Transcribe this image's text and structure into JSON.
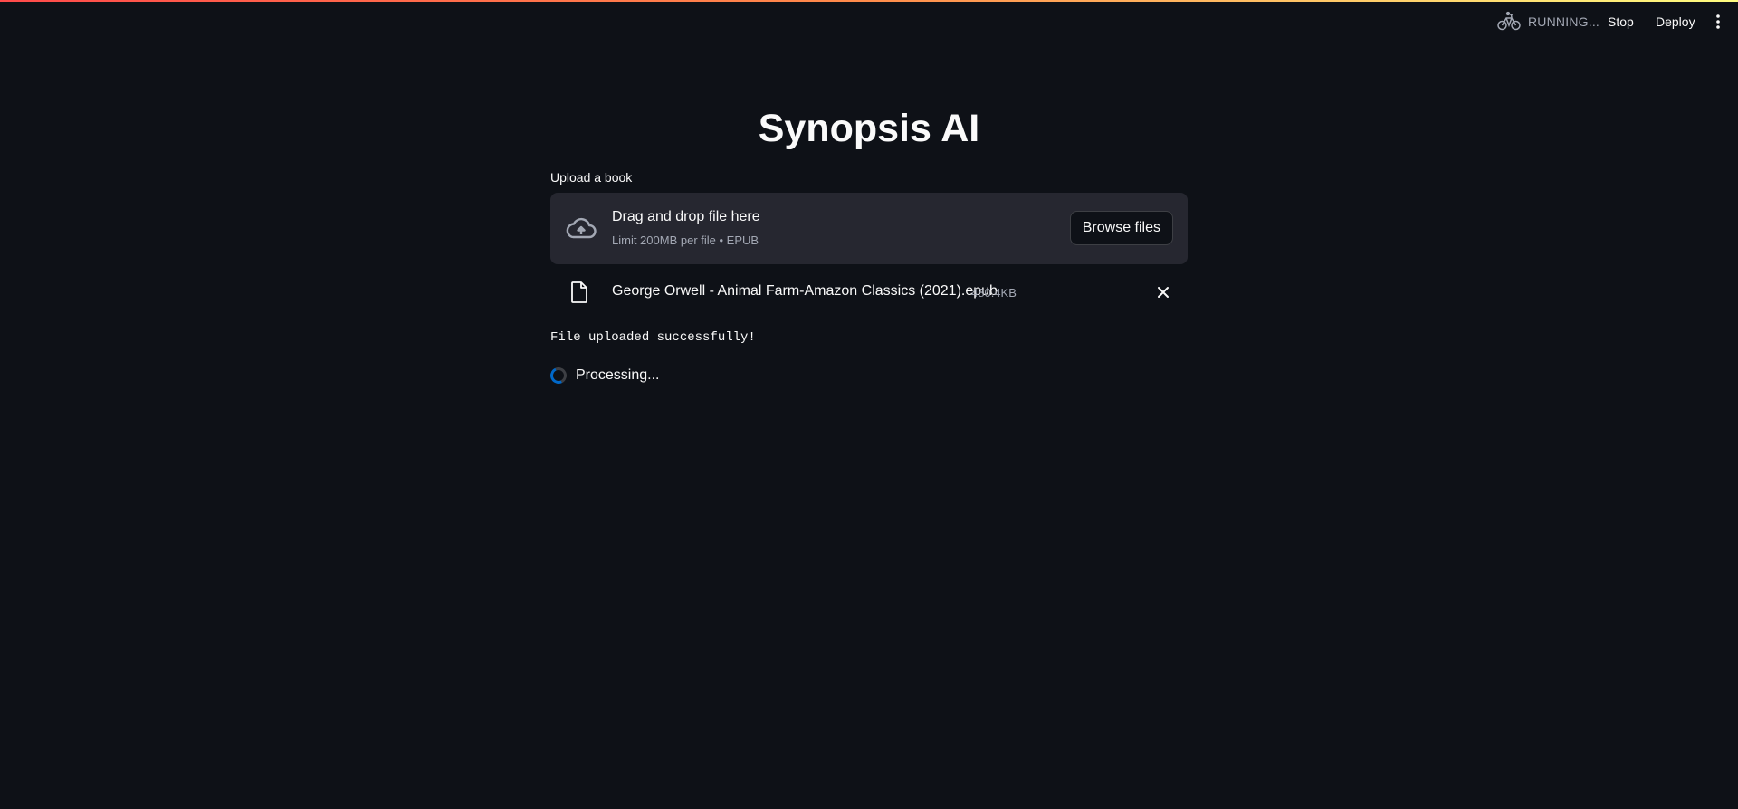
{
  "header": {
    "status": {
      "icon": "bicycle-icon",
      "text": "RUNNING..."
    },
    "stop_label": "Stop",
    "deploy_label": "Deploy",
    "menu_icon": "vertical-ellipsis-icon"
  },
  "main": {
    "title": "Synopsis AI",
    "uploader": {
      "label": "Upload a book",
      "drop_title": "Drag and drop file here",
      "limit_text": "Limit 200MB per file • EPUB",
      "browse_label": "Browse files",
      "upload_icon": "cloud-upload-icon"
    },
    "uploaded_file": {
      "icon": "file-icon",
      "name": "George Orwell - Animal Farm-Amazon Classics (2021).epub",
      "size": "480.4KB",
      "remove_icon": "close-icon"
    },
    "success_message": "File uploaded successfully!",
    "spinner_text": "Processing..."
  },
  "colors": {
    "background": "#0e1117",
    "surface": "#262730",
    "text": "#fafafa",
    "muted_text": "#a3a8b4",
    "spinner_accent": "#0068c9",
    "decoration_start": "#ff4b4b",
    "decoration_end": "#fffd80"
  }
}
